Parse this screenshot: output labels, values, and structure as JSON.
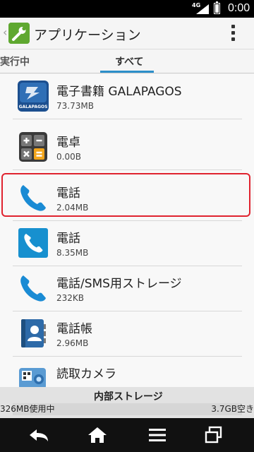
{
  "status_bar": {
    "network": "4G",
    "time": "0:00"
  },
  "action_bar": {
    "up_glyph": "‹",
    "title": "アプリケーション",
    "icon": "settings-wrench-icon",
    "overflow_icon": "overflow-menu-icon"
  },
  "tabs": [
    {
      "label": "実行中",
      "selected": false
    },
    {
      "label": "すべて",
      "selected": true
    }
  ],
  "accent_color": "#2c8fc9",
  "highlight_color": "#e0232f",
  "apps": [
    {
      "name": "電子書籍 GALAPAGOS",
      "size": "73.73MB",
      "icon": "galapagos-icon",
      "icon_text": "GALAPAGOS"
    },
    {
      "name": "電卓",
      "size": "0.00B",
      "icon": "calculator-icon"
    },
    {
      "name": "電話",
      "size": "2.04MB",
      "icon": "phone-icon",
      "highlighted": true
    },
    {
      "name": "電話",
      "size": "8.35MB",
      "icon": "phone-tile-icon"
    },
    {
      "name": "電話/SMS用ストレージ",
      "size": "232KB",
      "icon": "phone-icon"
    },
    {
      "name": "電話帳",
      "size": "2.96MB",
      "icon": "contacts-book-icon"
    },
    {
      "name": "読取カメラ",
      "size": "",
      "icon": "scan-camera-icon"
    }
  ],
  "storage": {
    "title": "内部ストレージ",
    "used": "326MB使用中",
    "free": "3.7GB空き"
  },
  "nav_bar": [
    "back-icon",
    "home-icon",
    "menu-icon",
    "recent-apps-icon"
  ]
}
